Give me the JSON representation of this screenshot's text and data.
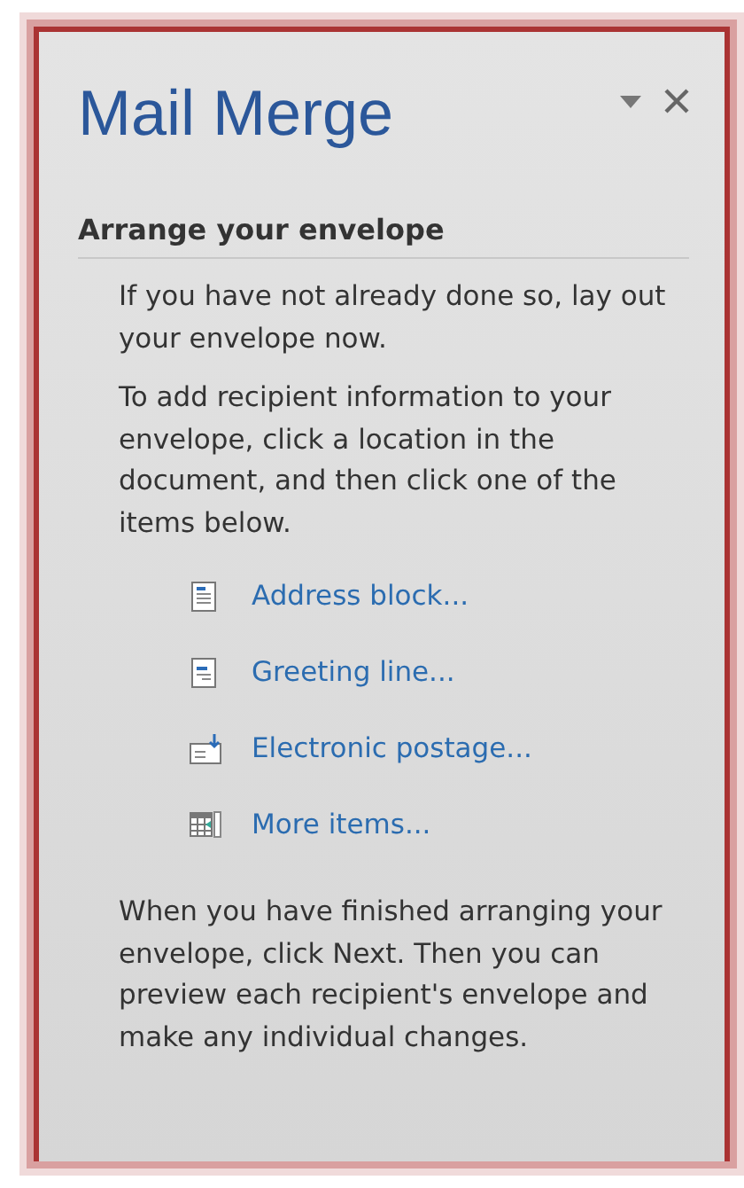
{
  "pane": {
    "title": "Mail Merge"
  },
  "section": {
    "heading": "Arrange your envelope",
    "intro": [
      "If you have not already done so, lay out your envelope now.",
      "To add recipient information to your envelope, click a location in the document, and then click one of the items below."
    ],
    "items": [
      {
        "label": "Address block...",
        "kind": "address"
      },
      {
        "label": "Greeting line...",
        "kind": "greeting"
      },
      {
        "label": "Electronic postage...",
        "kind": "postage"
      },
      {
        "label": "More items...",
        "kind": "more"
      }
    ],
    "outro": "When you have finished arranging your envelope, click Next. Then you can preview each recipient's envelope and make any individual changes."
  }
}
